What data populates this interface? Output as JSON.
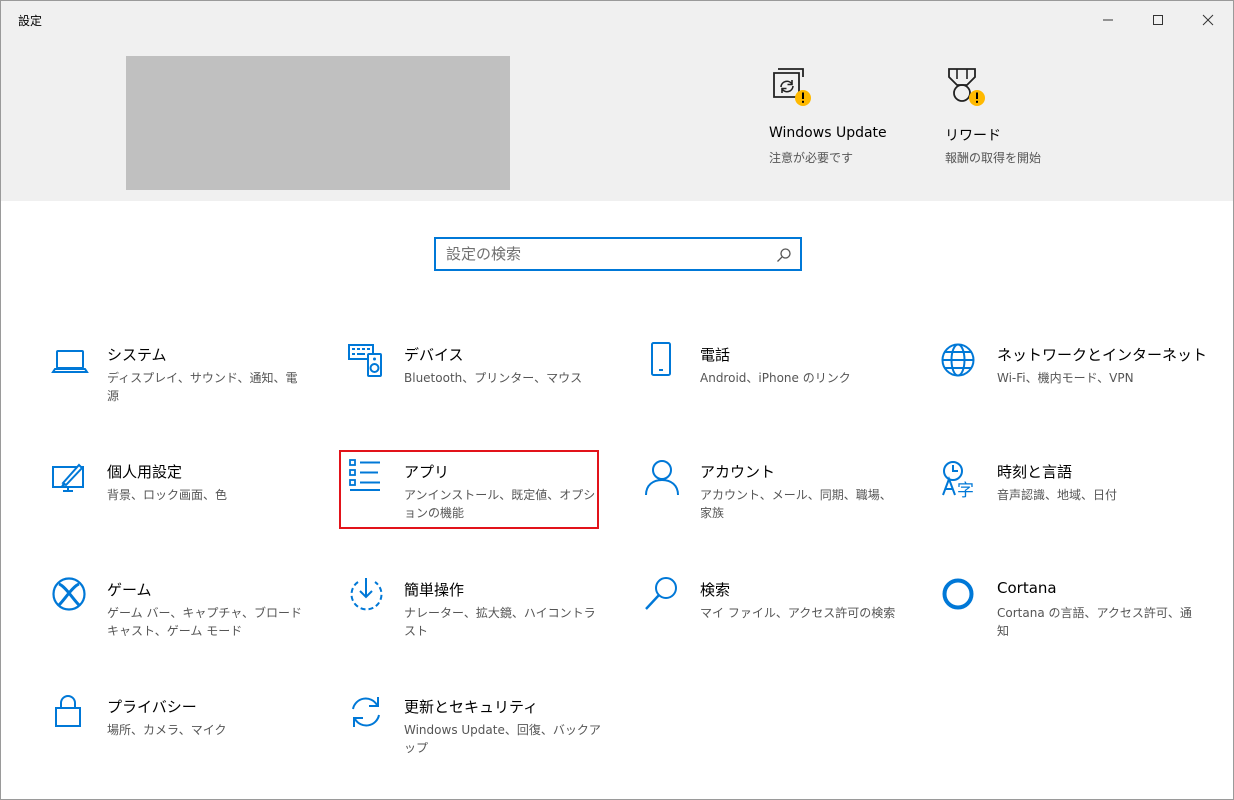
{
  "window": {
    "title": "設定"
  },
  "header": {
    "status_items": [
      {
        "name": "Windows Update",
        "subtitle": "注意が必要です",
        "icon": "windows-update-icon"
      },
      {
        "name": "リワード",
        "subtitle": "報酬の取得を開始",
        "icon": "rewards-icon"
      }
    ]
  },
  "search": {
    "placeholder": "設定の検索",
    "value": ""
  },
  "categories": [
    {
      "title": "システム",
      "desc": "ディスプレイ、サウンド、通知、電源",
      "icon": "laptop-icon"
    },
    {
      "title": "デバイス",
      "desc": "Bluetooth、プリンター、マウス",
      "icon": "keyboard-speaker-icon"
    },
    {
      "title": "電話",
      "desc": "Android、iPhone のリンク",
      "icon": "phone-icon"
    },
    {
      "title": "ネットワークとインターネット",
      "desc": "Wi-Fi、機内モード、VPN",
      "icon": "globe-icon"
    },
    {
      "title": "個人用設定",
      "desc": "背景、ロック画面、色",
      "icon": "pen-display-icon"
    },
    {
      "title": "アプリ",
      "desc": "アンインストール、既定値、オプションの機能",
      "icon": "apps-list-icon"
    },
    {
      "title": "アカウント",
      "desc": "アカウント、メール、同期、職場、家族",
      "icon": "person-icon"
    },
    {
      "title": "時刻と言語",
      "desc": "音声認識、地域、日付",
      "icon": "time-language-icon"
    },
    {
      "title": "ゲーム",
      "desc": "ゲーム バー、キャプチャ、ブロードキャスト、ゲーム モード",
      "icon": "xbox-icon"
    },
    {
      "title": "簡単操作",
      "desc": "ナレーター、拡大鏡、ハイコントラスト",
      "icon": "ease-of-access-icon"
    },
    {
      "title": "検索",
      "desc": "マイ ファイル、アクセス許可の検索",
      "icon": "magnifier-icon"
    },
    {
      "title": "Cortana",
      "desc": "Cortana の言語、アクセス許可、通知",
      "icon": "cortana-ring-icon"
    },
    {
      "title": "プライバシー",
      "desc": "場所、カメラ、マイク",
      "icon": "lock-icon"
    },
    {
      "title": "更新とセキュリティ",
      "desc": "Windows Update、回復、バックアップ",
      "icon": "sync-arrows-icon"
    }
  ],
  "colors": {
    "accent": "#0078d7",
    "warning_badge": "#ffb900",
    "highlight_border": "#e2131a",
    "header_background": "#f0f0f0"
  }
}
